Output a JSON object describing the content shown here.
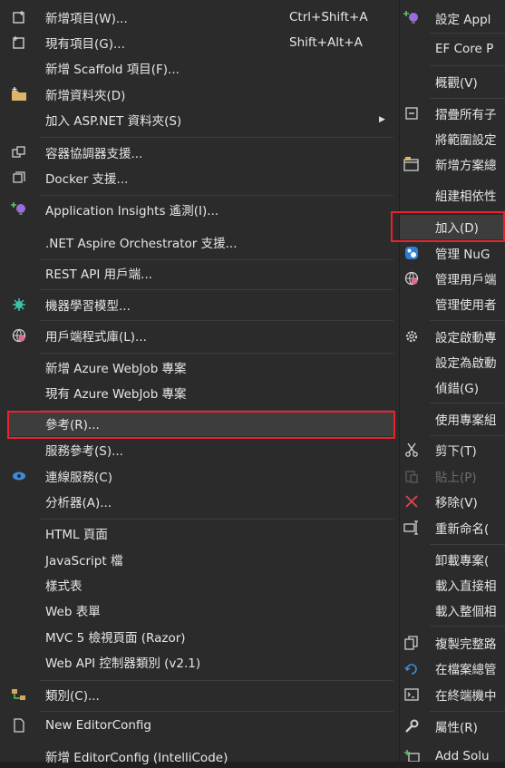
{
  "left_menu": {
    "items": [
      {
        "label": "新增項目(W)...",
        "shortcut": "Ctrl+Shift+A",
        "icon": "new-item-icon"
      },
      {
        "label": "現有項目(G)...",
        "shortcut": "Shift+Alt+A",
        "icon": "existing-item-icon"
      },
      {
        "label": "新增 Scaffold 項目(F)...",
        "shortcut": "",
        "icon": ""
      },
      {
        "label": "新增資料夾(D)",
        "shortcut": "",
        "icon": "new-folder-icon"
      },
      {
        "label": "加入 ASP.NET 資料夾(S)",
        "shortcut": "",
        "icon": "",
        "submenu": true
      },
      {
        "label": "容器協調器支援...",
        "shortcut": "",
        "icon": "container-orchestrator-icon"
      },
      {
        "label": "Docker 支援...",
        "shortcut": "",
        "icon": "docker-icon"
      },
      {
        "label": "Application Insights 遙測(I)...",
        "shortcut": "",
        "icon": "application-insights-icon"
      },
      {
        "label": ".NET Aspire Orchestrator 支援...",
        "shortcut": "",
        "icon": ""
      },
      {
        "label": "REST API 用戶端...",
        "shortcut": "",
        "icon": ""
      },
      {
        "label": "機器學習模型...",
        "shortcut": "",
        "icon": "machine-learning-icon"
      },
      {
        "label": "用戶端程式庫(L)...",
        "shortcut": "",
        "icon": "client-library-icon"
      },
      {
        "label": "新增 Azure WebJob 專案",
        "shortcut": "",
        "icon": ""
      },
      {
        "label": "現有 Azure WebJob 專案",
        "shortcut": "",
        "icon": ""
      },
      {
        "label": "參考(R)...",
        "shortcut": "",
        "icon": ""
      },
      {
        "label": "服務參考(S)...",
        "shortcut": "",
        "icon": ""
      },
      {
        "label": "連線服務(C)",
        "shortcut": "",
        "icon": "connected-service-icon"
      },
      {
        "label": "分析器(A)...",
        "shortcut": "",
        "icon": ""
      },
      {
        "label": "HTML 頁面",
        "shortcut": "",
        "icon": ""
      },
      {
        "label": "JavaScript 檔",
        "shortcut": "",
        "icon": ""
      },
      {
        "label": "樣式表",
        "shortcut": "",
        "icon": ""
      },
      {
        "label": "Web 表單",
        "shortcut": "",
        "icon": ""
      },
      {
        "label": "MVC 5 檢視頁面 (Razor)",
        "shortcut": "",
        "icon": ""
      },
      {
        "label": "Web API 控制器類別 (v2.1)",
        "shortcut": "",
        "icon": ""
      },
      {
        "label": "類別(C)...",
        "shortcut": "",
        "icon": "class-icon"
      },
      {
        "label": "New EditorConfig",
        "shortcut": "",
        "icon": "editorconfig-icon"
      },
      {
        "label": "新增 EditorConfig (IntelliCode)",
        "shortcut": "",
        "icon": ""
      }
    ]
  },
  "right_menu": {
    "items": [
      {
        "label": "設定 Appl",
        "icon": "application-insights-icon"
      },
      {
        "label": "EF Core P",
        "icon": ""
      },
      {
        "label": "概觀(V)",
        "icon": ""
      },
      {
        "label": "摺疊所有子",
        "icon": "collapse-icon"
      },
      {
        "label": "將範圍設定",
        "icon": ""
      },
      {
        "label": "新增方案總",
        "icon": "new-solution-explorer-icon"
      },
      {
        "label": "組建相依性",
        "icon": ""
      },
      {
        "label": "加入(D)",
        "icon": ""
      },
      {
        "label": "管理 NuG",
        "icon": "nuget-icon"
      },
      {
        "label": "管理用戶端",
        "icon": "client-library-icon"
      },
      {
        "label": "管理使用者",
        "icon": ""
      },
      {
        "label": "設定啟動專",
        "icon": "gear-icon"
      },
      {
        "label": "設定為啟動",
        "icon": ""
      },
      {
        "label": "偵錯(G)",
        "icon": ""
      },
      {
        "label": "使用專案組",
        "icon": ""
      },
      {
        "label": "剪下(T)",
        "icon": "cut-icon"
      },
      {
        "label": "貼上(P)",
        "icon": "paste-icon",
        "disabled": true
      },
      {
        "label": "移除(V)",
        "icon": "remove-icon"
      },
      {
        "label": "重新命名(",
        "icon": "rename-icon"
      },
      {
        "label": "卸載專案(",
        "icon": ""
      },
      {
        "label": "載入直接相",
        "icon": ""
      },
      {
        "label": "載入整個相",
        "icon": ""
      },
      {
        "label": "複製完整路",
        "icon": "copy-icon"
      },
      {
        "label": "在檔案總管",
        "icon": "open-folder-icon"
      },
      {
        "label": "在終端機中",
        "icon": "terminal-icon"
      },
      {
        "label": "屬性(R)",
        "icon": "wrench-icon"
      },
      {
        "label": "Add Solu",
        "icon": "add-solution-icon"
      }
    ]
  },
  "colors": {
    "background": "#2b2b2b",
    "highlight_border": "#e8232e",
    "separator": "#3d3d3d",
    "text": "#e6e6e6"
  }
}
